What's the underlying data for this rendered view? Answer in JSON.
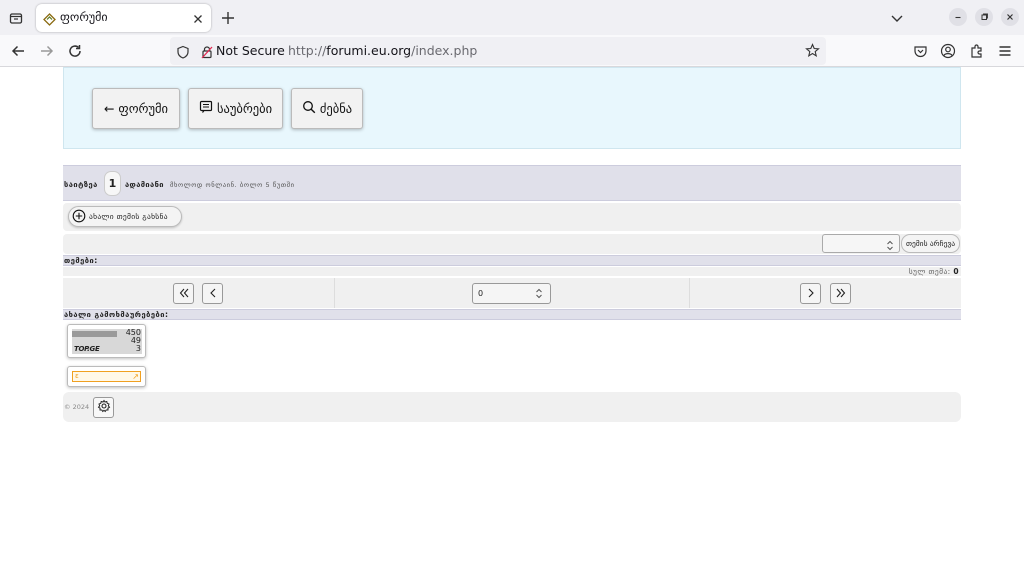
{
  "browser": {
    "tab_title": "ფორუმი",
    "security_label": "Not Secure",
    "url_prefix": "http://",
    "url_host": "forumi.eu.org",
    "url_path": "/index.php"
  },
  "header": {
    "back_label": "← ფორუმი",
    "messages_label": "საუბრები",
    "search_label": "ძებნა"
  },
  "online": {
    "label": "საიტზეა",
    "count": "1",
    "people_label": "ადამიანი",
    "note": "მხოლოდ ონლაინ. ბოლო 5 წუთში"
  },
  "actions": {
    "new_topic_label": "ახალი თემის გახსნა",
    "select_value": "",
    "select_topic_label": "თემის არჩევა"
  },
  "topics": {
    "header": "თემები:",
    "total_label": "სულ თემა:",
    "total_value": "0"
  },
  "pager": {
    "page_value": "0"
  },
  "comments": {
    "header": "ახალი გამოხმაურებები:"
  },
  "counter": {
    "values": [
      "450",
      "49",
      "3"
    ],
    "logo": "TOP.GE"
  },
  "footer": {
    "copyright": "© 2024"
  }
}
